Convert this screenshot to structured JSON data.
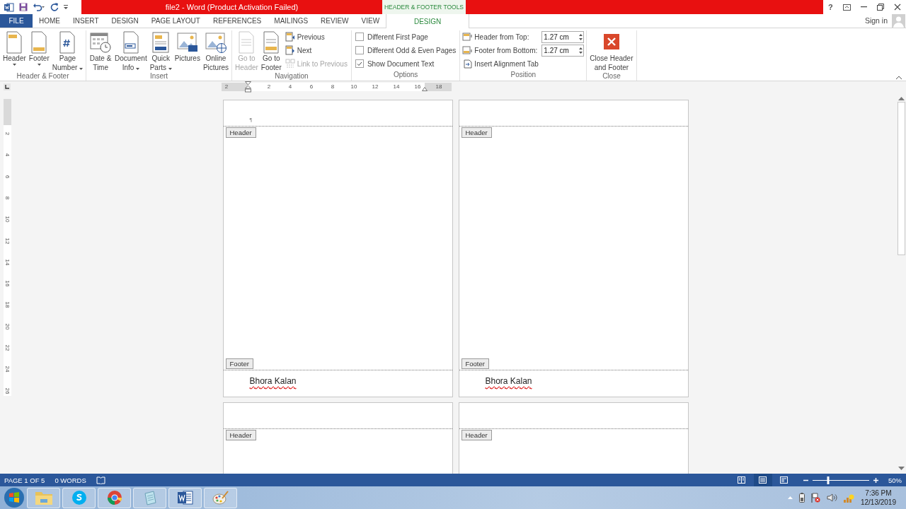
{
  "title_bar": {
    "title": "file2 -  Word (Product Activation Failed)",
    "context_label": "HEADER & FOOTER TOOLS",
    "help": "?"
  },
  "tabs": [
    {
      "label": "FILE",
      "kind": "file",
      "selected": false
    },
    {
      "label": "HOME",
      "kind": "normal",
      "selected": false
    },
    {
      "label": "INSERT",
      "kind": "normal",
      "selected": false
    },
    {
      "label": "DESIGN",
      "kind": "normal",
      "selected": false
    },
    {
      "label": "PAGE LAYOUT",
      "kind": "normal",
      "selected": false
    },
    {
      "label": "REFERENCES",
      "kind": "normal",
      "selected": false
    },
    {
      "label": "MAILINGS",
      "kind": "normal",
      "selected": false
    },
    {
      "label": "REVIEW",
      "kind": "normal",
      "selected": false
    },
    {
      "label": "VIEW",
      "kind": "normal",
      "selected": false
    },
    {
      "label": "DESIGN",
      "kind": "contextual",
      "selected": true
    }
  ],
  "account": {
    "label": "Sign in"
  },
  "ribbon": {
    "groups": [
      {
        "label": "Header & Footer",
        "columns": [
          [
            {
              "kind": "large",
              "lines": [
                "Header"
              ],
              "dropdown": true,
              "disabled": false
            }
          ],
          [
            {
              "kind": "large",
              "lines": [
                "Footer"
              ],
              "dropdown": true,
              "disabled": false
            }
          ],
          [
            {
              "kind": "large",
              "lines": [
                "Page",
                "Number"
              ],
              "dropdown": true,
              "disabled": false
            }
          ]
        ]
      },
      {
        "label": "Insert",
        "columns": [
          [
            {
              "kind": "large",
              "lines": [
                "Date &",
                "Time"
              ],
              "dropdown": false,
              "disabled": false
            }
          ],
          [
            {
              "kind": "large",
              "lines": [
                "Document",
                "Info"
              ],
              "dropdown": true,
              "disabled": false
            }
          ],
          [
            {
              "kind": "large",
              "lines": [
                "Quick",
                "Parts"
              ],
              "dropdown": true,
              "disabled": false
            }
          ],
          [
            {
              "kind": "large",
              "lines": [
                "Pictures"
              ],
              "dropdown": false,
              "disabled": false
            }
          ],
          [
            {
              "kind": "large",
              "lines": [
                "Online",
                "Pictures"
              ],
              "dropdown": false,
              "disabled": false
            }
          ]
        ]
      },
      {
        "label": "Navigation",
        "columns": [
          [
            {
              "kind": "large",
              "lines": [
                "Go to",
                "Header"
              ],
              "dropdown": false,
              "disabled": true
            }
          ],
          [
            {
              "kind": "large",
              "lines": [
                "Go to",
                "Footer"
              ],
              "dropdown": false,
              "disabled": false
            }
          ],
          [
            {
              "kind": "small",
              "label": "Previous",
              "disabled": false
            },
            {
              "kind": "small",
              "label": "Next",
              "disabled": false
            },
            {
              "kind": "small",
              "label": "Link to Previous",
              "disabled": true
            }
          ]
        ]
      },
      {
        "label": "Options",
        "columns": [
          [
            {
              "kind": "checkbox",
              "label": "Different First Page",
              "checked": false
            },
            {
              "kind": "checkbox",
              "label": "Different Odd & Even Pages",
              "checked": false
            },
            {
              "kind": "checkbox",
              "label": "Show Document Text",
              "checked": true
            }
          ]
        ]
      },
      {
        "label": "Position",
        "columns": [
          [
            {
              "kind": "spinner",
              "label": "Header from Top:",
              "value": "1.27 cm"
            },
            {
              "kind": "spinner",
              "label": "Footer from Bottom:",
              "value": "1.27 cm"
            },
            {
              "kind": "small",
              "label": "Insert Alignment Tab",
              "disabled": false
            }
          ]
        ]
      },
      {
        "label": "Close",
        "columns": [
          [
            {
              "kind": "large",
              "lines": [
                "Close Header",
                "and Footer"
              ],
              "dropdown": false,
              "disabled": false
            }
          ]
        ]
      }
    ]
  },
  "ruler": {
    "horizontal": [
      "2",
      "2",
      "4",
      "6",
      "8",
      "10",
      "12",
      "14",
      "16",
      "18"
    ],
    "vertical": [
      "2",
      "4",
      "6",
      "8",
      "10",
      "12",
      "14",
      "16",
      "18",
      "20",
      "22",
      "24",
      "26"
    ]
  },
  "pages": [
    {
      "header_mark": "¶",
      "header_tag": "Header",
      "footer_tag": "Footer",
      "footer_text": "Bhora Kalan",
      "spelling_error": true
    },
    {
      "header_tag": "Header",
      "footer_tag": "Footer",
      "footer_text": "Bhora Kalan",
      "spelling_error": true
    },
    {
      "header_tag": "Header"
    },
    {
      "header_tag": "Header"
    }
  ],
  "status_bar": {
    "page": "PAGE 1 OF 5",
    "words": "0 WORDS",
    "views": [
      {
        "selected": false
      },
      {
        "selected": true
      },
      {
        "selected": false
      }
    ],
    "zoom": {
      "level": 0.28,
      "reading": "50%"
    }
  },
  "clock": {
    "time": "7:36 PM",
    "date": "12/13/2019"
  }
}
